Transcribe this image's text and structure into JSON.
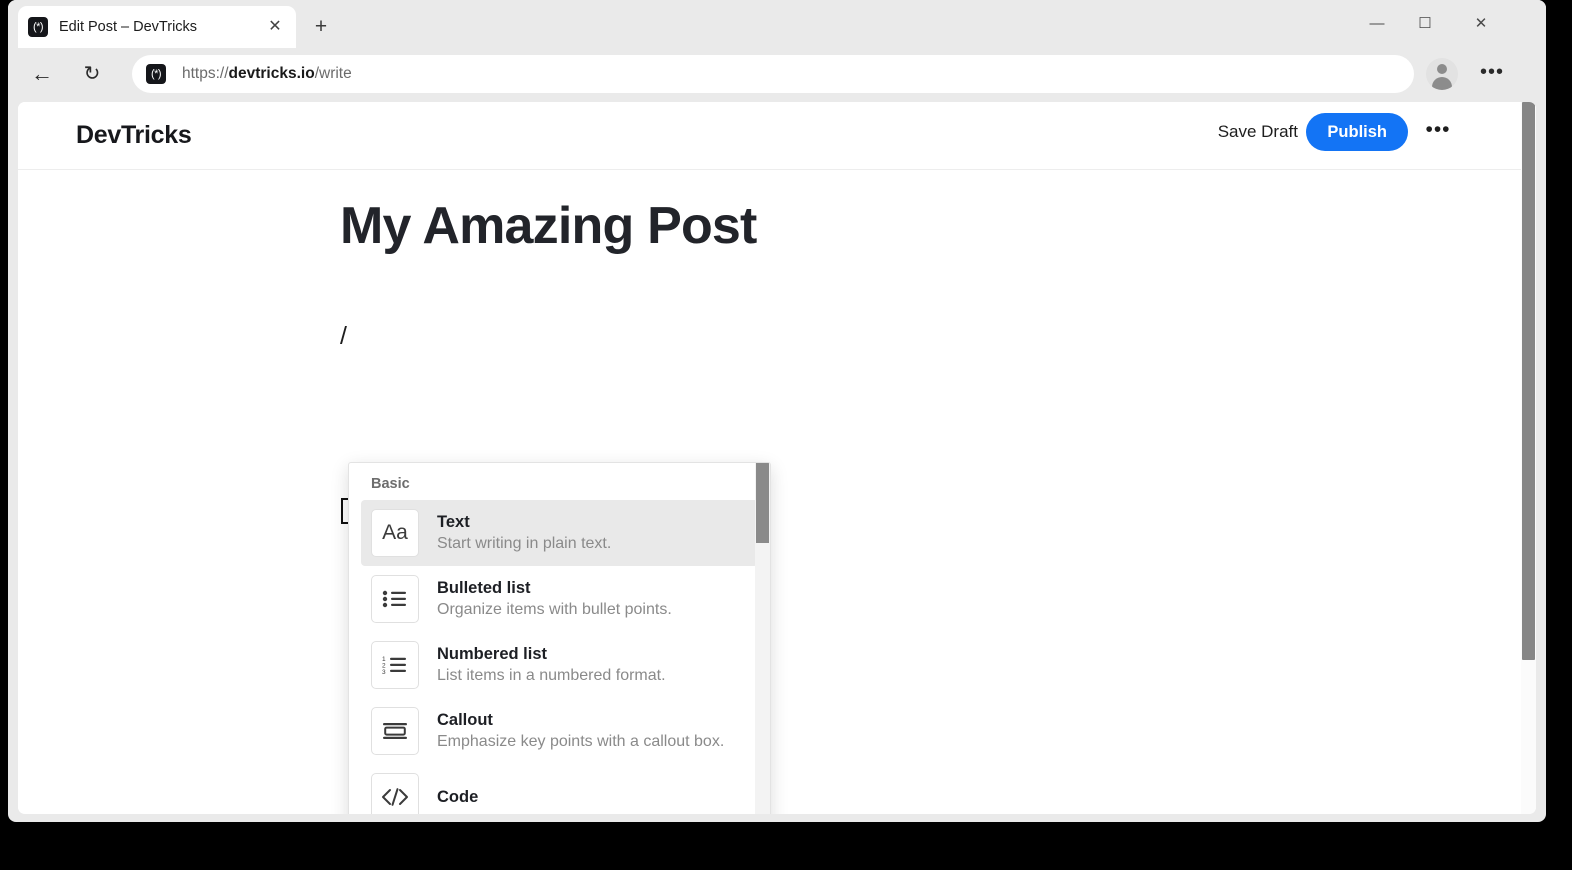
{
  "browser": {
    "tab": {
      "favicon": "app-favicon",
      "favicon_glyph": "(*)",
      "title": "Edit Post – DevTricks",
      "close_label": "✕"
    },
    "new_tab_label": "+",
    "window_controls": {
      "minimize": "—",
      "maximize": "☐",
      "close": "✕"
    },
    "nav": {
      "back_label": "←",
      "reload_label": "↻"
    },
    "address": {
      "favicon_glyph": "(*)",
      "url_prefix": "https://",
      "url_host": "devtricks.io",
      "url_path": "/write",
      "placeholder": "Search or enter web address"
    },
    "profile_label": "",
    "menu_label": "•••"
  },
  "app": {
    "brand": "DevTricks",
    "save_draft_label": "Save Draft",
    "publish_label": "Publish",
    "more_label": "•••",
    "accent_color": "#1374f5"
  },
  "editor": {
    "post_title": "My Amazing Post",
    "slash_text": "/"
  },
  "slash_menu": {
    "section_label": "Basic",
    "items": [
      {
        "title": "Text",
        "desc": "Start writing in plain text.",
        "icon": "text-aa-icon",
        "glyph": "Aa",
        "selected": true
      },
      {
        "title": "Bulleted list",
        "desc": "Organize items with bullet points.",
        "icon": "bulleted-list-icon",
        "glyph": "",
        "selected": false
      },
      {
        "title": "Numbered list",
        "desc": "List items in a numbered format.",
        "icon": "numbered-list-icon",
        "glyph": "",
        "selected": false
      },
      {
        "title": "Callout",
        "desc": "Emphasize key points with a callout box.",
        "icon": "callout-icon",
        "glyph": "",
        "selected": false
      },
      {
        "title": "Code",
        "desc": "",
        "icon": "code-icon",
        "glyph": "",
        "selected": false
      }
    ]
  }
}
